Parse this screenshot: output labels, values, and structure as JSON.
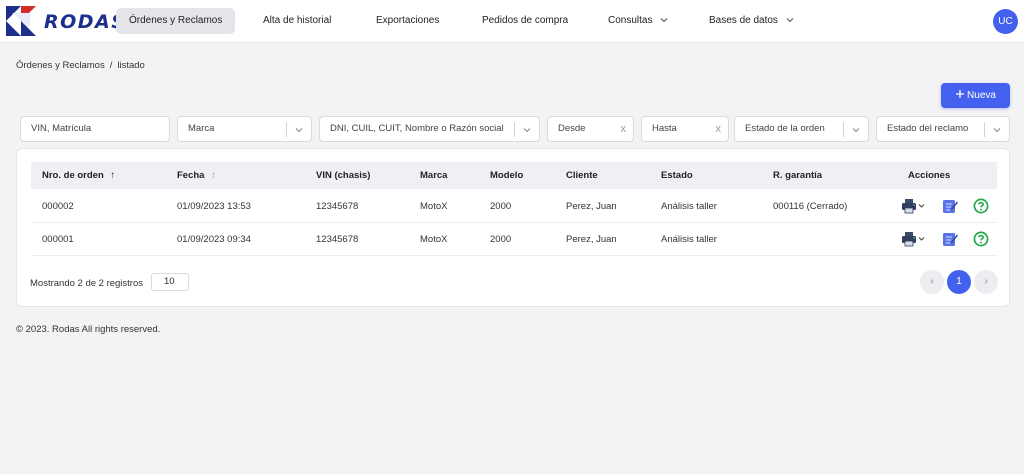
{
  "app": {
    "logo_text": "RODAS",
    "brand_color": "#1d2f8c",
    "accent_color": "#4361ee"
  },
  "nav": {
    "items": [
      {
        "label": "Órdenes y Reclamos",
        "active": true
      },
      {
        "label": "Alta de historial",
        "active": false
      },
      {
        "label": "Exportaciones",
        "active": false
      },
      {
        "label": "Pedidos de compra",
        "active": false
      },
      {
        "label": "Consultas",
        "active": false,
        "dropdown": true
      },
      {
        "label": "Bases de datos",
        "active": false,
        "dropdown": true
      }
    ],
    "user_initials": "UC"
  },
  "breadcrumb": {
    "section": "Órdenes y Reclamos",
    "separator": "/",
    "page": "listado"
  },
  "toolbar": {
    "new_label": "Nueva",
    "new_icon": "plus-icon"
  },
  "filters": {
    "vin_placeholder": "VIN, Matrícula",
    "marca_placeholder": "Marca",
    "cliente_placeholder": "DNI, CUIL, CUIT, Nombre o Razón social",
    "desde_placeholder": "Desde",
    "hasta_placeholder": "Hasta",
    "estado_orden_placeholder": "Estado de la orden",
    "estado_reclamo_placeholder": "Estado del reclamo",
    "clear_glyph": "x"
  },
  "table": {
    "columns": {
      "nro": "Nro. de orden",
      "nro_sort": "↑",
      "fecha": "Fecha",
      "fecha_sort": "↕",
      "vin": "VIN (chasis)",
      "marca": "Marca",
      "modelo": "Modelo",
      "cliente": "Cliente",
      "estado": "Estado",
      "garantia": "R. garantía",
      "acciones": "Acciones"
    },
    "rows": [
      {
        "nro": "000002",
        "fecha": "01/09/2023 13:53",
        "vin": "12345678",
        "marca": "MotoX",
        "modelo": "2000",
        "cliente": "Perez, Juan",
        "estado": "Análisis taller",
        "garantia": "000116 (Cerrado)"
      },
      {
        "nro": "000001",
        "fecha": "01/09/2023 09:34",
        "vin": "12345678",
        "marca": "MotoX",
        "modelo": "2000",
        "cliente": "Perez, Juan",
        "estado": "Análisis taller",
        "garantia": ""
      }
    ],
    "action_icons": [
      "printer-icon",
      "edit-icon",
      "help-icon"
    ]
  },
  "pagination": {
    "info": "Mostrando 2 de 2 registros",
    "page_size": "10",
    "prev": "‹",
    "current": "1",
    "next": "›"
  },
  "footer": {
    "copyright": "© 2023. Rodas All rights reserved."
  }
}
